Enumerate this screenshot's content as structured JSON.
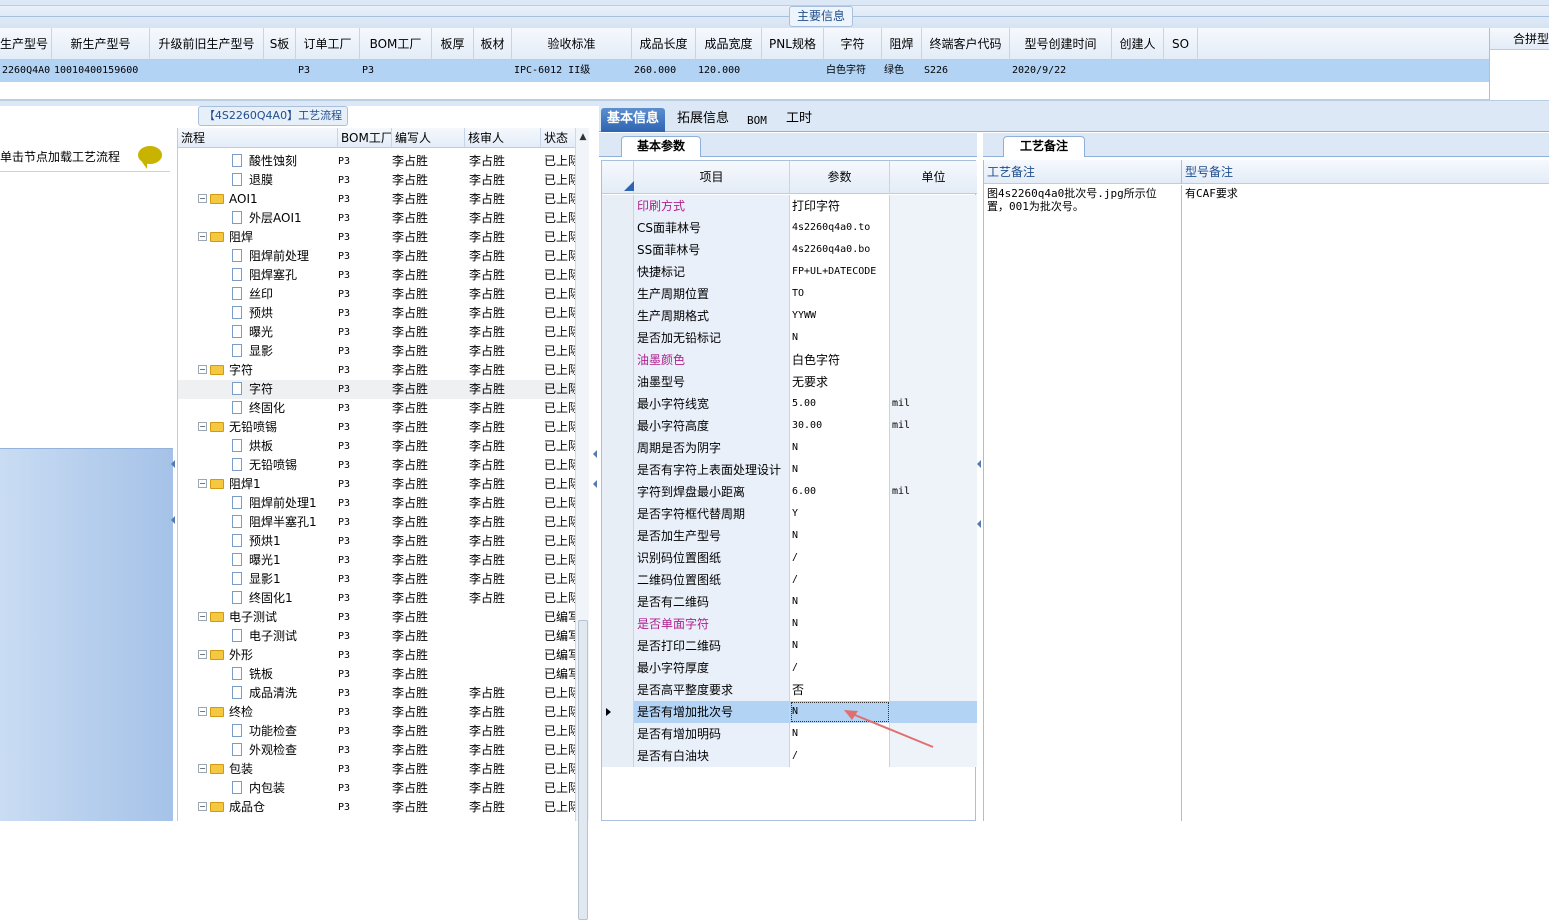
{
  "main_info_label": "主要信息",
  "merge_header": "合拼型",
  "top_grid": {
    "columns": [
      "生产型号",
      "新生产型号",
      "升级前旧生产型号",
      "S板",
      "订单工厂",
      "BOM工厂",
      "板厚",
      "板材",
      "验收标准",
      "成品长度",
      "成品宽度",
      "PNL规格",
      "字符",
      "阻焊",
      "终端客户代码",
      "型号创建时间",
      "创建人",
      "SO"
    ],
    "row": [
      "2260Q4A0",
      "10010400159600",
      "",
      "",
      "P3",
      "P3",
      "",
      "",
      "IPC-6012 II级",
      "260.000",
      "120.000",
      "",
      "白色字符",
      "绿色",
      "S226",
      "2020/9/22",
      "",
      ""
    ]
  },
  "left_panel": {
    "hint": "单击节点加载工艺流程"
  },
  "tree_panel": {
    "title": "【4S2260Q4A0】工艺流程",
    "headers": [
      "流程",
      "BOM工厂",
      "编写人",
      "核审人",
      "状态"
    ],
    "rows": [
      {
        "type": "leaf",
        "name": "酸性蚀刻",
        "bom": "P3",
        "writer": "李占胜",
        "reviewer": "李占胜",
        "status": "已上际"
      },
      {
        "type": "leaf",
        "name": "退膜",
        "bom": "P3",
        "writer": "李占胜",
        "reviewer": "李占胜",
        "status": "已上际"
      },
      {
        "type": "group",
        "name": "AOI1",
        "bom": "P3",
        "writer": "李占胜",
        "reviewer": "李占胜",
        "status": "已上际"
      },
      {
        "type": "leaf",
        "name": "外层AOI1",
        "bom": "P3",
        "writer": "李占胜",
        "reviewer": "李占胜",
        "status": "已上际"
      },
      {
        "type": "group",
        "name": "阻焊",
        "bom": "P3",
        "writer": "李占胜",
        "reviewer": "李占胜",
        "status": "已上际"
      },
      {
        "type": "leaf",
        "name": "阻焊前处理",
        "bom": "P3",
        "writer": "李占胜",
        "reviewer": "李占胜",
        "status": "已上际"
      },
      {
        "type": "leaf",
        "name": "阻焊塞孔",
        "bom": "P3",
        "writer": "李占胜",
        "reviewer": "李占胜",
        "status": "已上际"
      },
      {
        "type": "leaf",
        "name": "丝印",
        "bom": "P3",
        "writer": "李占胜",
        "reviewer": "李占胜",
        "status": "已上际"
      },
      {
        "type": "leaf",
        "name": "预烘",
        "bom": "P3",
        "writer": "李占胜",
        "reviewer": "李占胜",
        "status": "已上际"
      },
      {
        "type": "leaf",
        "name": "曝光",
        "bom": "P3",
        "writer": "李占胜",
        "reviewer": "李占胜",
        "status": "已上际"
      },
      {
        "type": "leaf",
        "name": "显影",
        "bom": "P3",
        "writer": "李占胜",
        "reviewer": "李占胜",
        "status": "已上际"
      },
      {
        "type": "group",
        "name": "字符",
        "bom": "P3",
        "writer": "李占胜",
        "reviewer": "李占胜",
        "status": "已上际"
      },
      {
        "type": "leaf",
        "name": "字符",
        "bom": "P3",
        "writer": "李占胜",
        "reviewer": "李占胜",
        "status": "已上际",
        "selected": true
      },
      {
        "type": "leaf",
        "name": "终固化",
        "bom": "P3",
        "writer": "李占胜",
        "reviewer": "李占胜",
        "status": "已上际"
      },
      {
        "type": "group",
        "name": "无铅喷锡",
        "bom": "P3",
        "writer": "李占胜",
        "reviewer": "李占胜",
        "status": "已上际"
      },
      {
        "type": "leaf",
        "name": "烘板",
        "bom": "P3",
        "writer": "李占胜",
        "reviewer": "李占胜",
        "status": "已上际"
      },
      {
        "type": "leaf",
        "name": "无铅喷锡",
        "bom": "P3",
        "writer": "李占胜",
        "reviewer": "李占胜",
        "status": "已上际"
      },
      {
        "type": "group",
        "name": "阻焊1",
        "bom": "P3",
        "writer": "李占胜",
        "reviewer": "李占胜",
        "status": "已上际"
      },
      {
        "type": "leaf",
        "name": "阻焊前处理1",
        "bom": "P3",
        "writer": "李占胜",
        "reviewer": "李占胜",
        "status": "已上际"
      },
      {
        "type": "leaf",
        "name": "阻焊半塞孔1",
        "bom": "P3",
        "writer": "李占胜",
        "reviewer": "李占胜",
        "status": "已上际"
      },
      {
        "type": "leaf",
        "name": "预烘1",
        "bom": "P3",
        "writer": "李占胜",
        "reviewer": "李占胜",
        "status": "已上际"
      },
      {
        "type": "leaf",
        "name": "曝光1",
        "bom": "P3",
        "writer": "李占胜",
        "reviewer": "李占胜",
        "status": "已上际"
      },
      {
        "type": "leaf",
        "name": "显影1",
        "bom": "P3",
        "writer": "李占胜",
        "reviewer": "李占胜",
        "status": "已上际"
      },
      {
        "type": "leaf",
        "name": "终固化1",
        "bom": "P3",
        "writer": "李占胜",
        "reviewer": "李占胜",
        "status": "已上际"
      },
      {
        "type": "group",
        "name": "电子测试",
        "bom": "P3",
        "writer": "李占胜",
        "reviewer": "",
        "status": "已编写"
      },
      {
        "type": "leaf",
        "name": "电子测试",
        "bom": "P3",
        "writer": "李占胜",
        "reviewer": "",
        "status": "已编写"
      },
      {
        "type": "group",
        "name": "外形",
        "bom": "P3",
        "writer": "李占胜",
        "reviewer": "",
        "status": "已编写"
      },
      {
        "type": "leaf",
        "name": "铣板",
        "bom": "P3",
        "writer": "李占胜",
        "reviewer": "",
        "status": "已编写"
      },
      {
        "type": "leaf",
        "name": "成品清洗",
        "bom": "P3",
        "writer": "李占胜",
        "reviewer": "李占胜",
        "status": "已上际"
      },
      {
        "type": "group",
        "name": "终检",
        "bom": "P3",
        "writer": "李占胜",
        "reviewer": "李占胜",
        "status": "已上际"
      },
      {
        "type": "leaf",
        "name": "功能检查",
        "bom": "P3",
        "writer": "李占胜",
        "reviewer": "李占胜",
        "status": "已上际"
      },
      {
        "type": "leaf",
        "name": "外观检查",
        "bom": "P3",
        "writer": "李占胜",
        "reviewer": "李占胜",
        "status": "已上际"
      },
      {
        "type": "group",
        "name": "包装",
        "bom": "P3",
        "writer": "李占胜",
        "reviewer": "李占胜",
        "status": "已上际"
      },
      {
        "type": "leaf",
        "name": "内包装",
        "bom": "P3",
        "writer": "李占胜",
        "reviewer": "李占胜",
        "status": "已上际"
      },
      {
        "type": "group",
        "name": "成品仓",
        "bom": "P3",
        "writer": "李占胜",
        "reviewer": "李占胜",
        "status": "已上际"
      }
    ]
  },
  "mid_tabs": [
    "基本信息",
    "拓展信息",
    "BOM",
    "工时"
  ],
  "sub_tab": "基本参数",
  "param_grid": {
    "headers": [
      "项目",
      "参数",
      "单位"
    ],
    "rows": [
      {
        "key": "印刷方式",
        "value": "打印字符",
        "unit": "",
        "pink": true
      },
      {
        "key": "CS面菲林号",
        "value": "4s2260q4a0.to",
        "unit": ""
      },
      {
        "key": "SS面菲林号",
        "value": "4s2260q4a0.bo",
        "unit": ""
      },
      {
        "key": "快捷标记",
        "value": "FP+UL+DATECODE",
        "unit": ""
      },
      {
        "key": "生产周期位置",
        "value": "TO",
        "unit": ""
      },
      {
        "key": "生产周期格式",
        "value": "YYWW",
        "unit": ""
      },
      {
        "key": "是否加无铅标记",
        "value": "N",
        "unit": ""
      },
      {
        "key": "油墨颜色",
        "value": "白色字符",
        "unit": "",
        "pink": true
      },
      {
        "key": "油墨型号",
        "value": "无要求",
        "unit": ""
      },
      {
        "key": "最小字符线宽",
        "value": "5.00",
        "unit": "mil"
      },
      {
        "key": "最小字符高度",
        "value": "30.00",
        "unit": "mil"
      },
      {
        "key": "周期是否为阴字",
        "value": "N",
        "unit": ""
      },
      {
        "key": "是否有字符上表面处理设计",
        "value": "N",
        "unit": ""
      },
      {
        "key": "字符到焊盘最小距离",
        "value": "6.00",
        "unit": "mil"
      },
      {
        "key": "是否字符框代替周期",
        "value": "Y",
        "unit": ""
      },
      {
        "key": "是否加生产型号",
        "value": "N",
        "unit": ""
      },
      {
        "key": "识别码位置图纸",
        "value": "/",
        "unit": ""
      },
      {
        "key": "二维码位置图纸",
        "value": "/",
        "unit": ""
      },
      {
        "key": "是否有二维码",
        "value": "N",
        "unit": ""
      },
      {
        "key": "是否单面字符",
        "value": "N",
        "unit": "",
        "pink": true
      },
      {
        "key": "是否打印二维码",
        "value": "N",
        "unit": ""
      },
      {
        "key": "最小字符厚度",
        "value": "/",
        "unit": ""
      },
      {
        "key": "是否高平整度要求",
        "value": "否",
        "unit": ""
      },
      {
        "key": "是否有增加批次号",
        "value": "N",
        "unit": "",
        "current": true
      },
      {
        "key": "是否有增加明码",
        "value": "N",
        "unit": ""
      },
      {
        "key": "是否有白油块",
        "value": "/",
        "unit": ""
      }
    ]
  },
  "notes": {
    "tab": "工艺备注",
    "col1_header": "工艺备注",
    "col2_header": "型号备注",
    "col1_text": "图4s2260q4a0批次号.jpg所示位置，001为批次号。",
    "col2_text": "有CAF要求"
  },
  "colors": {
    "accent": "#2e64b1",
    "selection": "#b3d3f5",
    "pink_label": "#b0208f",
    "annotation_arrow": "#e07070"
  }
}
